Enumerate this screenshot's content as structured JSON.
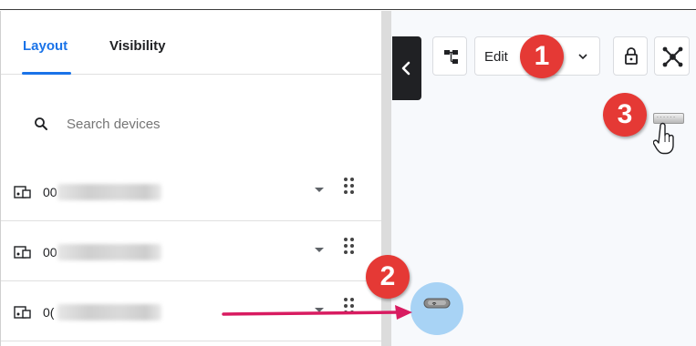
{
  "tabs": {
    "layout_label": "Layout",
    "visibility_label": "Visibility",
    "active": "Layout"
  },
  "search": {
    "placeholder": "Search devices"
  },
  "devices": [
    {
      "name_prefix": "00",
      "icon": "device-icon"
    },
    {
      "name_prefix": "00",
      "icon": "device-icon"
    },
    {
      "name_prefix": "0(",
      "icon": "device-icon"
    }
  ],
  "toolbar": {
    "edit_label": "Edit",
    "tree_icon": "tree-icon",
    "lock_icon": "lock-icon",
    "node_icon": "network-node-icon",
    "collapse_icon": "chevron-left-icon"
  },
  "annotations": {
    "step_1": "1",
    "step_2": "2",
    "step_3": "3"
  },
  "colors": {
    "accent": "#1a73e8",
    "badge": "#e53935",
    "arrow": "#d81b60",
    "drop_target": "#a8d3f5",
    "collapse_button": "#202124"
  }
}
